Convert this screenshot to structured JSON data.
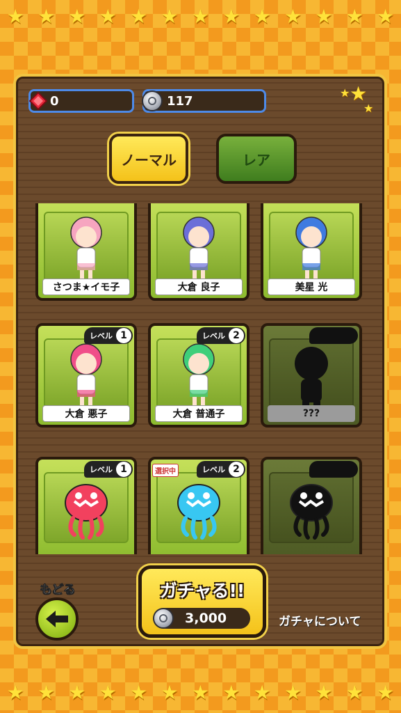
{
  "currency": {
    "gems": "0",
    "coins": "117"
  },
  "tabs": {
    "normal": "ノーマル",
    "rare": "レア"
  },
  "level_prefix": "レベル",
  "selected_tag": "選択中",
  "cards": [
    {
      "name": "さつま★イモ子",
      "level": "",
      "locked": false,
      "selected": false,
      "color": "#f6a5c0"
    },
    {
      "name": "大倉 良子",
      "level": "",
      "locked": false,
      "selected": false,
      "color": "#6b6fd8"
    },
    {
      "name": "美星 光",
      "level": "",
      "locked": false,
      "selected": false,
      "color": "#3f7be0"
    },
    {
      "name": "大倉 悪子",
      "level": "1",
      "locked": false,
      "selected": false,
      "color": "#f04e89"
    },
    {
      "name": "大倉 普通子",
      "level": "2",
      "locked": false,
      "selected": false,
      "color": "#3fcf7a"
    },
    {
      "name": "???",
      "level": "",
      "locked": true,
      "selected": false,
      "color": "#111111"
    },
    {
      "name": "",
      "level": "1",
      "locked": false,
      "selected": false,
      "color": "#f2415e"
    },
    {
      "name": "",
      "level": "2",
      "locked": false,
      "selected": true,
      "color": "#38c7f2"
    },
    {
      "name": "",
      "level": "",
      "locked": true,
      "selected": false,
      "color": "#111111"
    }
  ],
  "back_button": {
    "label": "もどる"
  },
  "gacha_button": {
    "label": "ガチャる!!",
    "cost": "3,000"
  },
  "about_link": "ガチャについて"
}
